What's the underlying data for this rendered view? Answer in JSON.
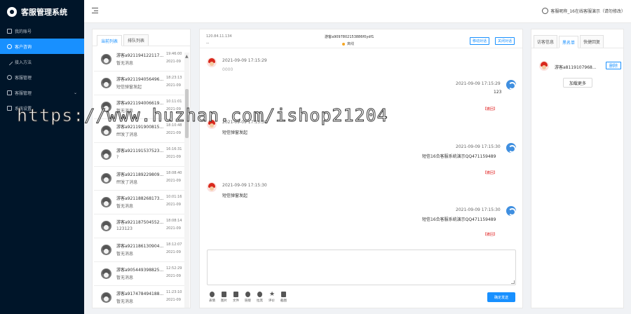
{
  "app": {
    "title": "客服管理系统"
  },
  "sidebar": {
    "items": [
      {
        "label": "我的账号"
      },
      {
        "label": "客户咨询"
      },
      {
        "label": "接入方法"
      },
      {
        "label": "客服管理"
      },
      {
        "label": "客服管理"
      },
      {
        "label": "系统设置"
      }
    ]
  },
  "header": {
    "user": "客服昵称_16在线客服演示（请勿修改）"
  },
  "left": {
    "tabs": [
      "当前列表",
      "排队列表"
    ],
    "conversations": [
      {
        "name": "游客a921194122117...",
        "time": "19:46:00",
        "date": "2021-09",
        "msg": "暂无消息"
      },
      {
        "name": "游客a921194056496...",
        "time": "18:23:13",
        "date": "2021-09",
        "msg": "短信弹窗发起"
      },
      {
        "name": "游客a921194006619...",
        "time": "10:11:01",
        "date": "2021-09",
        "msg": "暂无消息"
      },
      {
        "name": "游客a921191900815...",
        "time": "18:10:48",
        "date": "2021-09",
        "msg": "fff发了消息"
      },
      {
        "name": "游客a921191537523...",
        "time": "16:16:31",
        "date": "2021-09",
        "msg": "?"
      },
      {
        "name": "游客a921189229809...",
        "time": "18:08:40",
        "date": "2021-09",
        "msg": "fff发了消息"
      },
      {
        "name": "游客a921188268173...",
        "time": "10:01:16",
        "date": "2021-09",
        "msg": "暂无消息"
      },
      {
        "name": "游客a921187504552...",
        "time": "18:08:14",
        "date": "2021-09",
        "msg": "123123"
      },
      {
        "name": "游客a921186130904...",
        "time": "18:12:07",
        "date": "2021-09",
        "msg": "暂无消息"
      },
      {
        "name": "游客a905449398825...",
        "time": "12:52:29",
        "date": "2021-09",
        "msg": "暂无消息"
      },
      {
        "name": "游客a917478494188...",
        "time": "11:23:10",
        "date": "2021-09",
        "msg": "暂无消息"
      }
    ]
  },
  "chat": {
    "ip": "120.84.11.134",
    "dash": "--",
    "visitor": "游客a9097802153886f0ydf1",
    "status": "离线",
    "transfer_label": "移动对话",
    "close_label": "关闭对话",
    "messages": [
      {
        "time": "2021-09-09 17:15:29",
        "text": "0000"
      },
      {
        "time": "2021-09-09 17:15:29",
        "text": "123",
        "recall": "【撤回】"
      },
      {
        "time": "2021-09-09 17:15:30",
        "text": "短信弹窗发起"
      },
      {
        "time": "2021-09-09 17:15:30",
        "text": "短信16合客服系统演示QQ471159489",
        "recall": "【撤回】"
      },
      {
        "time": "2021-09-09 17:15:30",
        "text": "短信弹窗发起"
      },
      {
        "time": "2021-09-09 17:15:30",
        "text": "短信16合客服系统演示QQ471159489",
        "recall": "【撤回】"
      }
    ],
    "tools": [
      "表情",
      "图片",
      "文件",
      "链接",
      "拉黑",
      "评价",
      "截图"
    ],
    "send_label": "确定发送"
  },
  "right": {
    "tabs": [
      "访客信息",
      "黑名单",
      "快捷回复"
    ],
    "blacklist_name": "游客a811910796​8...",
    "delete_label": "删除",
    "more_label": "加载更多"
  },
  "watermark": "https://www.huzhan.com/ishop21204"
}
